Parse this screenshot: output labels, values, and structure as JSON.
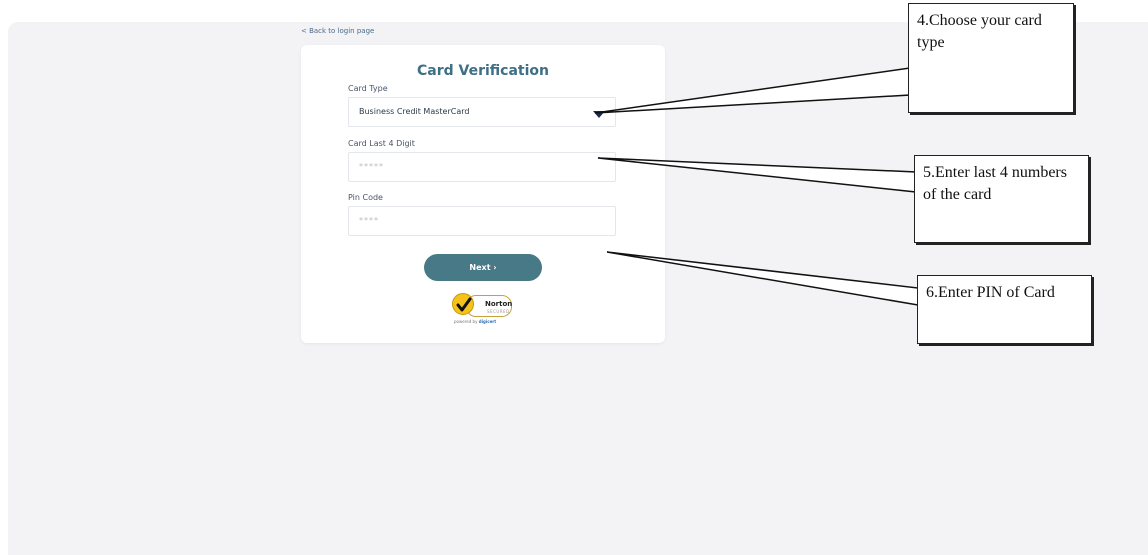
{
  "back_link": "< Back to login page",
  "title": "Card Verification",
  "card_type": {
    "label": "Card Type",
    "value": "Business Credit MasterCard"
  },
  "card_last4": {
    "label": "Card Last 4 Digit",
    "placeholder": "*****"
  },
  "pin": {
    "label": "Pin Code",
    "placeholder": "****"
  },
  "next_button": "Next ›",
  "norton": {
    "brand": "Norton",
    "secured": "SECURED",
    "powered_by": "powered by",
    "powered_brand": "digicert"
  },
  "annotations": {
    "step4": "4.Choose your card type",
    "step5": "5.Enter last 4 numbers of the card",
    "step6": "6.Enter PIN of Card"
  },
  "colors": {
    "accent": "#477a86",
    "title": "#3e6f86",
    "background": "#f3f3f6"
  }
}
